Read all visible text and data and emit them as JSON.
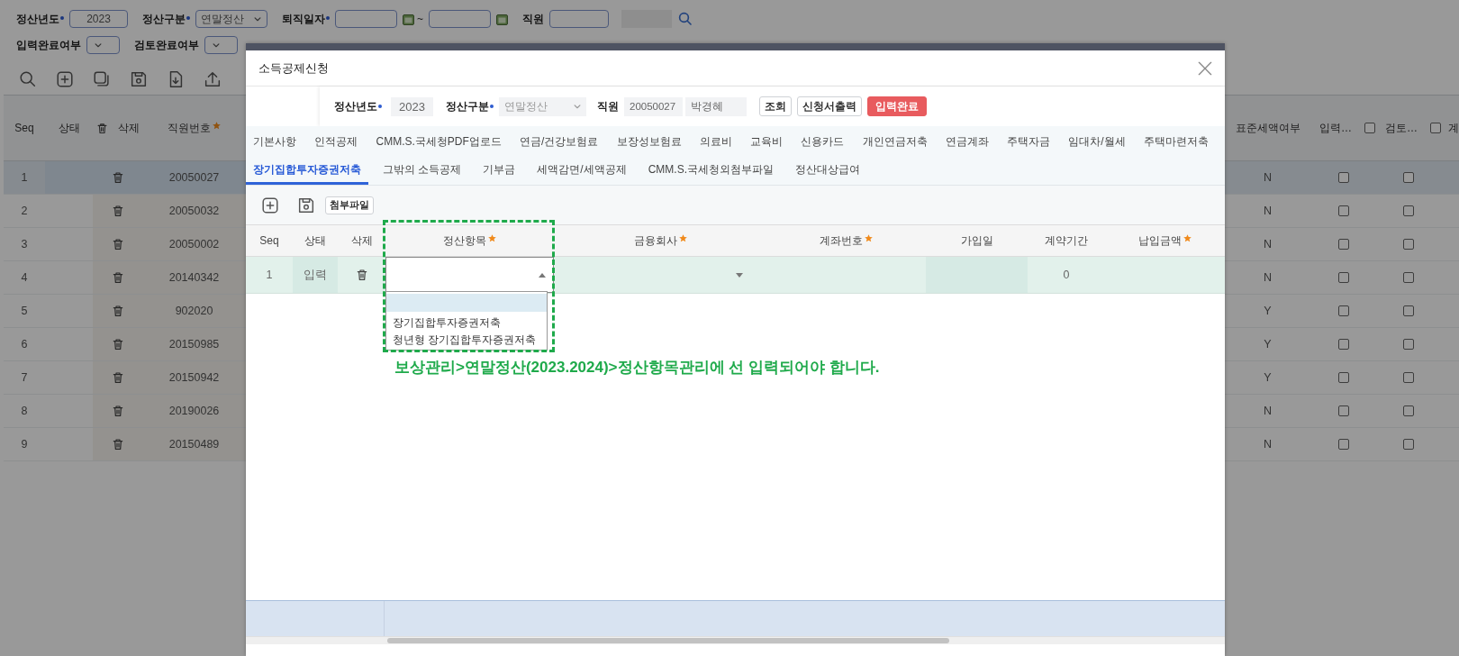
{
  "filters": [
    {
      "kind": "input",
      "label": "정산년도",
      "required": true,
      "value": "2023"
    },
    {
      "kind": "select",
      "label": "정산구분",
      "required": true,
      "value": "연말정산"
    },
    {
      "kind": "daterange",
      "label": "퇴직일자",
      "required": true,
      "separator": "~"
    },
    {
      "kind": "employee",
      "label": "직원",
      "required": false
    }
  ],
  "filters_row2": [
    {
      "kind": "select",
      "label": "입력완료여부",
      "required": false
    },
    {
      "kind": "select",
      "label": "검토완료여부",
      "required": false
    }
  ],
  "main_table": {
    "columns_left": [
      {
        "label": "Seq",
        "kind": "text",
        "required": false
      },
      {
        "label": "상태",
        "kind": "text",
        "required": false
      },
      {
        "label": "삭제",
        "kind": "trash",
        "required": false
      },
      {
        "label": "직원번호",
        "kind": "text",
        "required": true
      }
    ],
    "columns_right": [
      {
        "label": "표준세액여부",
        "kind": "text"
      },
      {
        "label": "입력…",
        "kind": "check",
        "checked": false
      },
      {
        "label": "검토…",
        "kind": "check",
        "checked": false
      },
      {
        "label": "계",
        "kind": "text"
      }
    ],
    "rows": [
      {
        "seq": "1",
        "employee_no": "20050027",
        "standard_tax": "N",
        "input_done": false,
        "review_done": false,
        "selected": true
      },
      {
        "seq": "2",
        "employee_no": "20050032",
        "standard_tax": "N",
        "input_done": false,
        "review_done": false,
        "selected": false
      },
      {
        "seq": "3",
        "employee_no": "20050002",
        "standard_tax": "N",
        "input_done": false,
        "review_done": false,
        "selected": false
      },
      {
        "seq": "4",
        "employee_no": "20140342",
        "standard_tax": "N",
        "input_done": false,
        "review_done": false,
        "selected": false
      },
      {
        "seq": "5",
        "employee_no": "902020",
        "standard_tax": "Y",
        "input_done": false,
        "review_done": false,
        "selected": false
      },
      {
        "seq": "6",
        "employee_no": "20150985",
        "standard_tax": "Y",
        "input_done": false,
        "review_done": false,
        "selected": false
      },
      {
        "seq": "7",
        "employee_no": "20150942",
        "standard_tax": "Y",
        "input_done": false,
        "review_done": false,
        "selected": false
      },
      {
        "seq": "8",
        "employee_no": "20190026",
        "standard_tax": "N",
        "input_done": false,
        "review_done": false,
        "selected": false
      },
      {
        "seq": "9",
        "employee_no": "20150489",
        "standard_tax": "N",
        "input_done": false,
        "review_done": false,
        "selected": false
      }
    ]
  },
  "dialog": {
    "title": "소득공제신청",
    "search": {
      "year_label": "정산년도",
      "year_required": true,
      "year": "2023",
      "type_label": "정산구분",
      "type_required": true,
      "type": "연말정산",
      "employee_label": "직원",
      "employee_no": "20050027",
      "employee_name": "박경혜",
      "buttons": [
        {
          "label": "조회",
          "kind": "plain"
        },
        {
          "label": "신청서출력",
          "kind": "plain"
        },
        {
          "label": "입력완료",
          "kind": "danger"
        }
      ]
    },
    "tabs": [
      [
        {
          "label": "기본사항",
          "selected": false
        },
        {
          "label": "인적공제",
          "selected": false
        },
        {
          "label": "CMM.S.국세청PDF업로드",
          "selected": false
        },
        {
          "label": "연금/건강보험료",
          "selected": false
        },
        {
          "label": "보장성보험료",
          "selected": false
        },
        {
          "label": "의료비",
          "selected": false
        },
        {
          "label": "교육비",
          "selected": false
        },
        {
          "label": "신용카드",
          "selected": false
        },
        {
          "label": "개인연금저축",
          "selected": false
        },
        {
          "label": "연금계좌",
          "selected": false
        },
        {
          "label": "주택자금",
          "selected": false
        },
        {
          "label": "임대차/월세",
          "selected": false
        },
        {
          "label": "주택마련저축",
          "selected": false
        }
      ],
      [
        {
          "label": "장기집합투자증권저축",
          "selected": true
        },
        {
          "label": "그밖의 소득공제",
          "selected": false
        },
        {
          "label": "기부금",
          "selected": false
        },
        {
          "label": "세액감면/세액공제",
          "selected": false
        },
        {
          "label": "CMM.S.국세청외첨부파일",
          "selected": false
        },
        {
          "label": "정산대상급여",
          "selected": false
        }
      ]
    ],
    "attach_button": "첨부파일",
    "grid": {
      "columns": [
        {
          "label": "Seq",
          "required": false
        },
        {
          "label": "상태",
          "required": false
        },
        {
          "label": "삭제",
          "required": false
        },
        {
          "label": "정산항목",
          "required": true
        },
        {
          "label": "금융회사",
          "required": true
        },
        {
          "label": "계좌번호",
          "required": true
        },
        {
          "label": "가입일",
          "required": false
        },
        {
          "label": "계약기간",
          "required": false
        },
        {
          "label": "납입금액",
          "required": true
        }
      ],
      "rows": [
        {
          "seq": "1",
          "status": "입력",
          "contract_period": "0"
        }
      ],
      "dropdown": {
        "expanded": true,
        "options": [
          {
            "highlighted": true
          },
          {
            "label": "장기집합투자증권저축",
            "highlighted": false
          },
          {
            "label": "청년형 장기집합투자증권저축",
            "highlighted": false
          }
        ]
      }
    },
    "annotation": "보상관리>연말정산(2023.2024)>정산항목관리에 선 입력되어야 합니다."
  }
}
